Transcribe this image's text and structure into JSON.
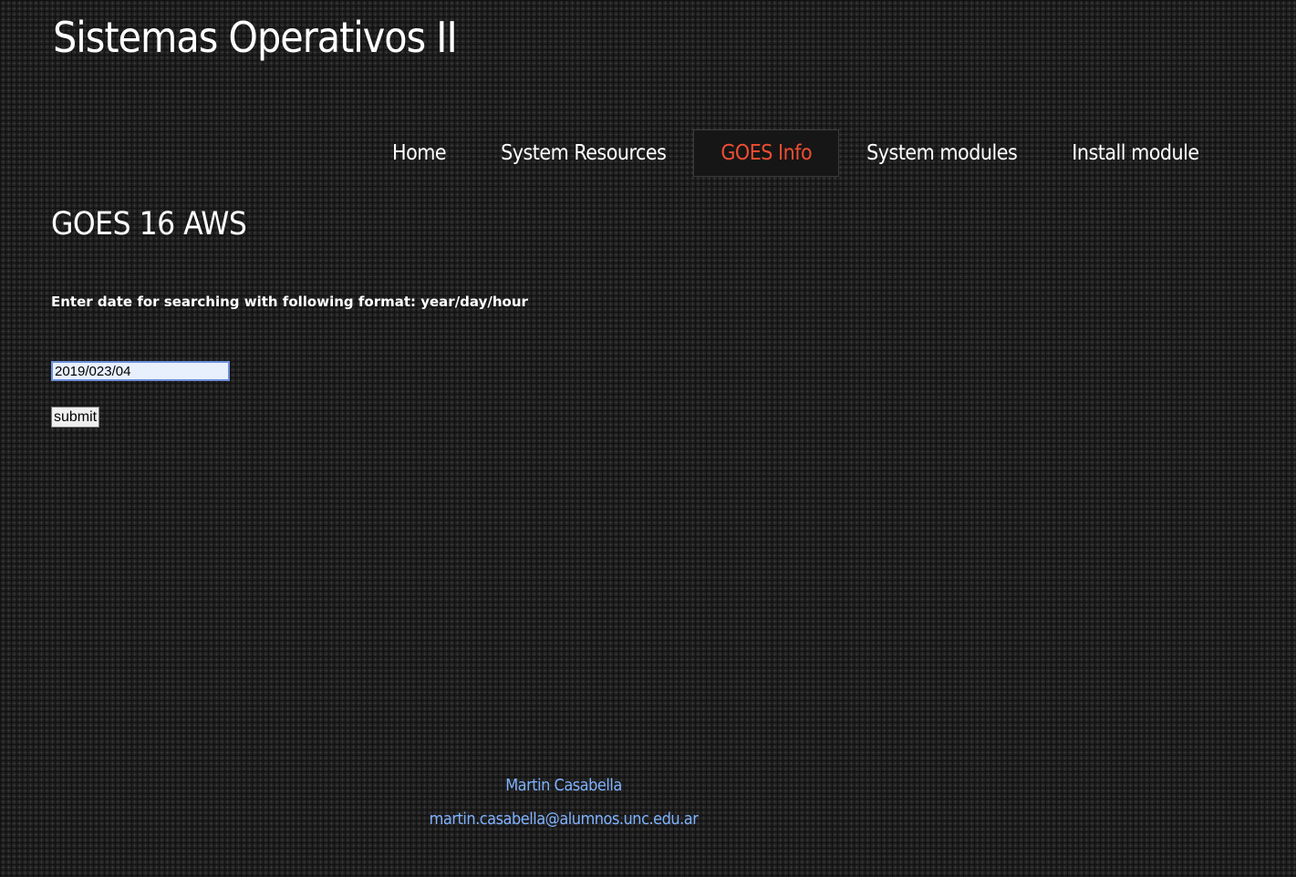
{
  "site": {
    "title": "Sistemas Operativos II"
  },
  "nav": {
    "items": [
      {
        "label": "Home",
        "active": false
      },
      {
        "label": "System Resources",
        "active": false
      },
      {
        "label": "GOES Info",
        "active": true
      },
      {
        "label": "System modules",
        "active": false
      },
      {
        "label": "Install module",
        "active": false
      }
    ]
  },
  "main": {
    "heading": "GOES 16 AWS",
    "instructions": "Enter date for searching with following format: year/day/hour",
    "date_input_value": "2019/023/04",
    "submit_label": "submit"
  },
  "footer": {
    "name": "Martin Casabella",
    "email": "martin.casabella@alumnos.unc.edu.ar"
  },
  "colors": {
    "active_nav": "#ef4e33",
    "footer_link": "#7fb2ff",
    "input_border": "#6d8fd8"
  }
}
